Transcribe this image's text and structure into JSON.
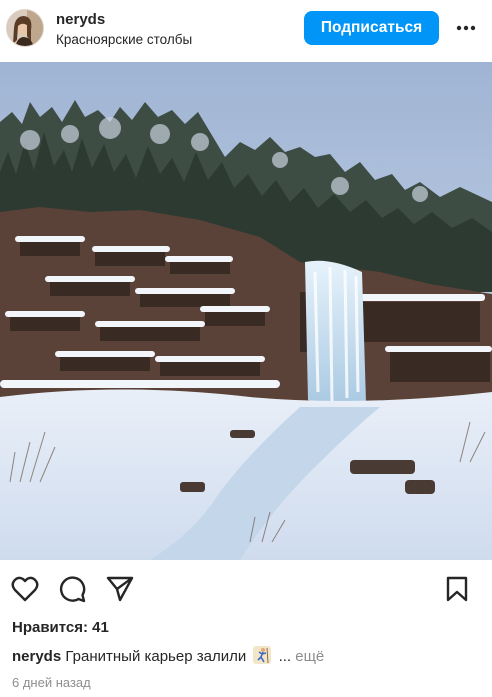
{
  "post": {
    "username": "neryds",
    "location": "Красноярские столбы",
    "follow_label": "Подписаться",
    "likes_text": "Нравится: 41",
    "caption_username": "neryds",
    "caption_text": "Гранитный карьер залили",
    "caption_ellipsis": "...",
    "more_label": "ещё",
    "timestamp": "6 дней назад"
  },
  "icons": {
    "more": "more-horizontal-icon",
    "like": "heart-icon",
    "comment": "comment-icon",
    "share": "send-icon",
    "save": "bookmark-icon",
    "caption_emoji": "climber-emoji"
  },
  "colors": {
    "accent": "#0095f6",
    "text": "#262626",
    "muted": "#8e8e8e"
  }
}
